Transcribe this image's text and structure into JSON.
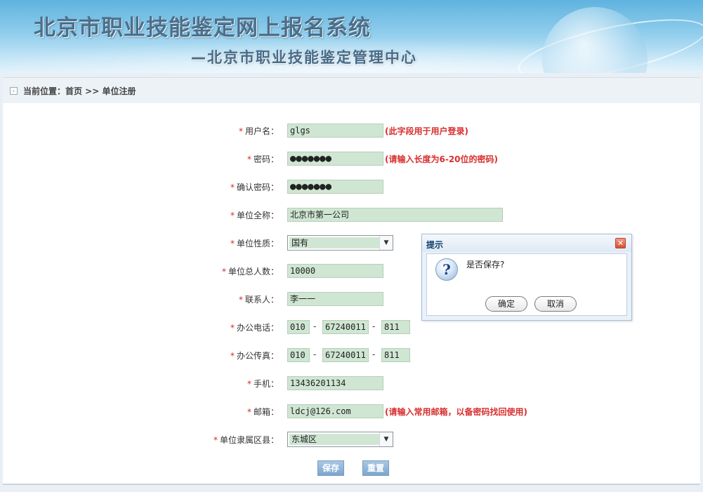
{
  "banner": {
    "title": "北京市职业技能鉴定网上报名系统",
    "subtitle": "—北京市职业技能鉴定管理中心"
  },
  "breadcrumb": {
    "text": "当前位置：首页 >> 单位注册"
  },
  "form": {
    "username": {
      "label": "用户名：",
      "value": "glgs",
      "hint": "(此字段用于用户登录)"
    },
    "password": {
      "label": "密码：",
      "value": "●●●●●●●",
      "hint": "(请输入长度为6-20位的密码)"
    },
    "confirm_password": {
      "label": "确认密码：",
      "value": "●●●●●●●"
    },
    "org_name": {
      "label": "单位全称：",
      "value": "北京市第一公司"
    },
    "org_type": {
      "label": "单位性质：",
      "selected": "国有"
    },
    "headcount": {
      "label": "单位总人数：",
      "value": "10000"
    },
    "contact": {
      "label": "联系人：",
      "value": "李一一"
    },
    "office_phone": {
      "label": "办公电话：",
      "area": "010",
      "number": "67240011",
      "ext": "811"
    },
    "office_fax": {
      "label": "办公传真：",
      "area": "010",
      "number": "67240011",
      "ext": "811"
    },
    "mobile": {
      "label": "手机：",
      "value": "13436201134"
    },
    "email": {
      "label": "邮箱：",
      "value": "ldcj@126.com",
      "hint": "(请输入常用邮箱，以备密码找回使用)"
    },
    "district": {
      "label": "单位隶属区县：",
      "selected": "东城区"
    },
    "required_mark": "*",
    "dash": "-",
    "save_label": "保存",
    "reset_label": "重置"
  },
  "dialog": {
    "title": "提示",
    "message": "是否保存?",
    "ok_label": "确定",
    "cancel_label": "取消",
    "icon_glyph": "?",
    "close_glyph": "✕"
  },
  "colors": {
    "required": "#d02b2b",
    "hint": "#d82e2e",
    "field_bg": "#cfe6d3",
    "button": "#7aa6cf"
  },
  "icons": {
    "breadcrumb": "box-arrow-icon",
    "dialog": "question-icon",
    "dialog_close": "close-icon"
  }
}
